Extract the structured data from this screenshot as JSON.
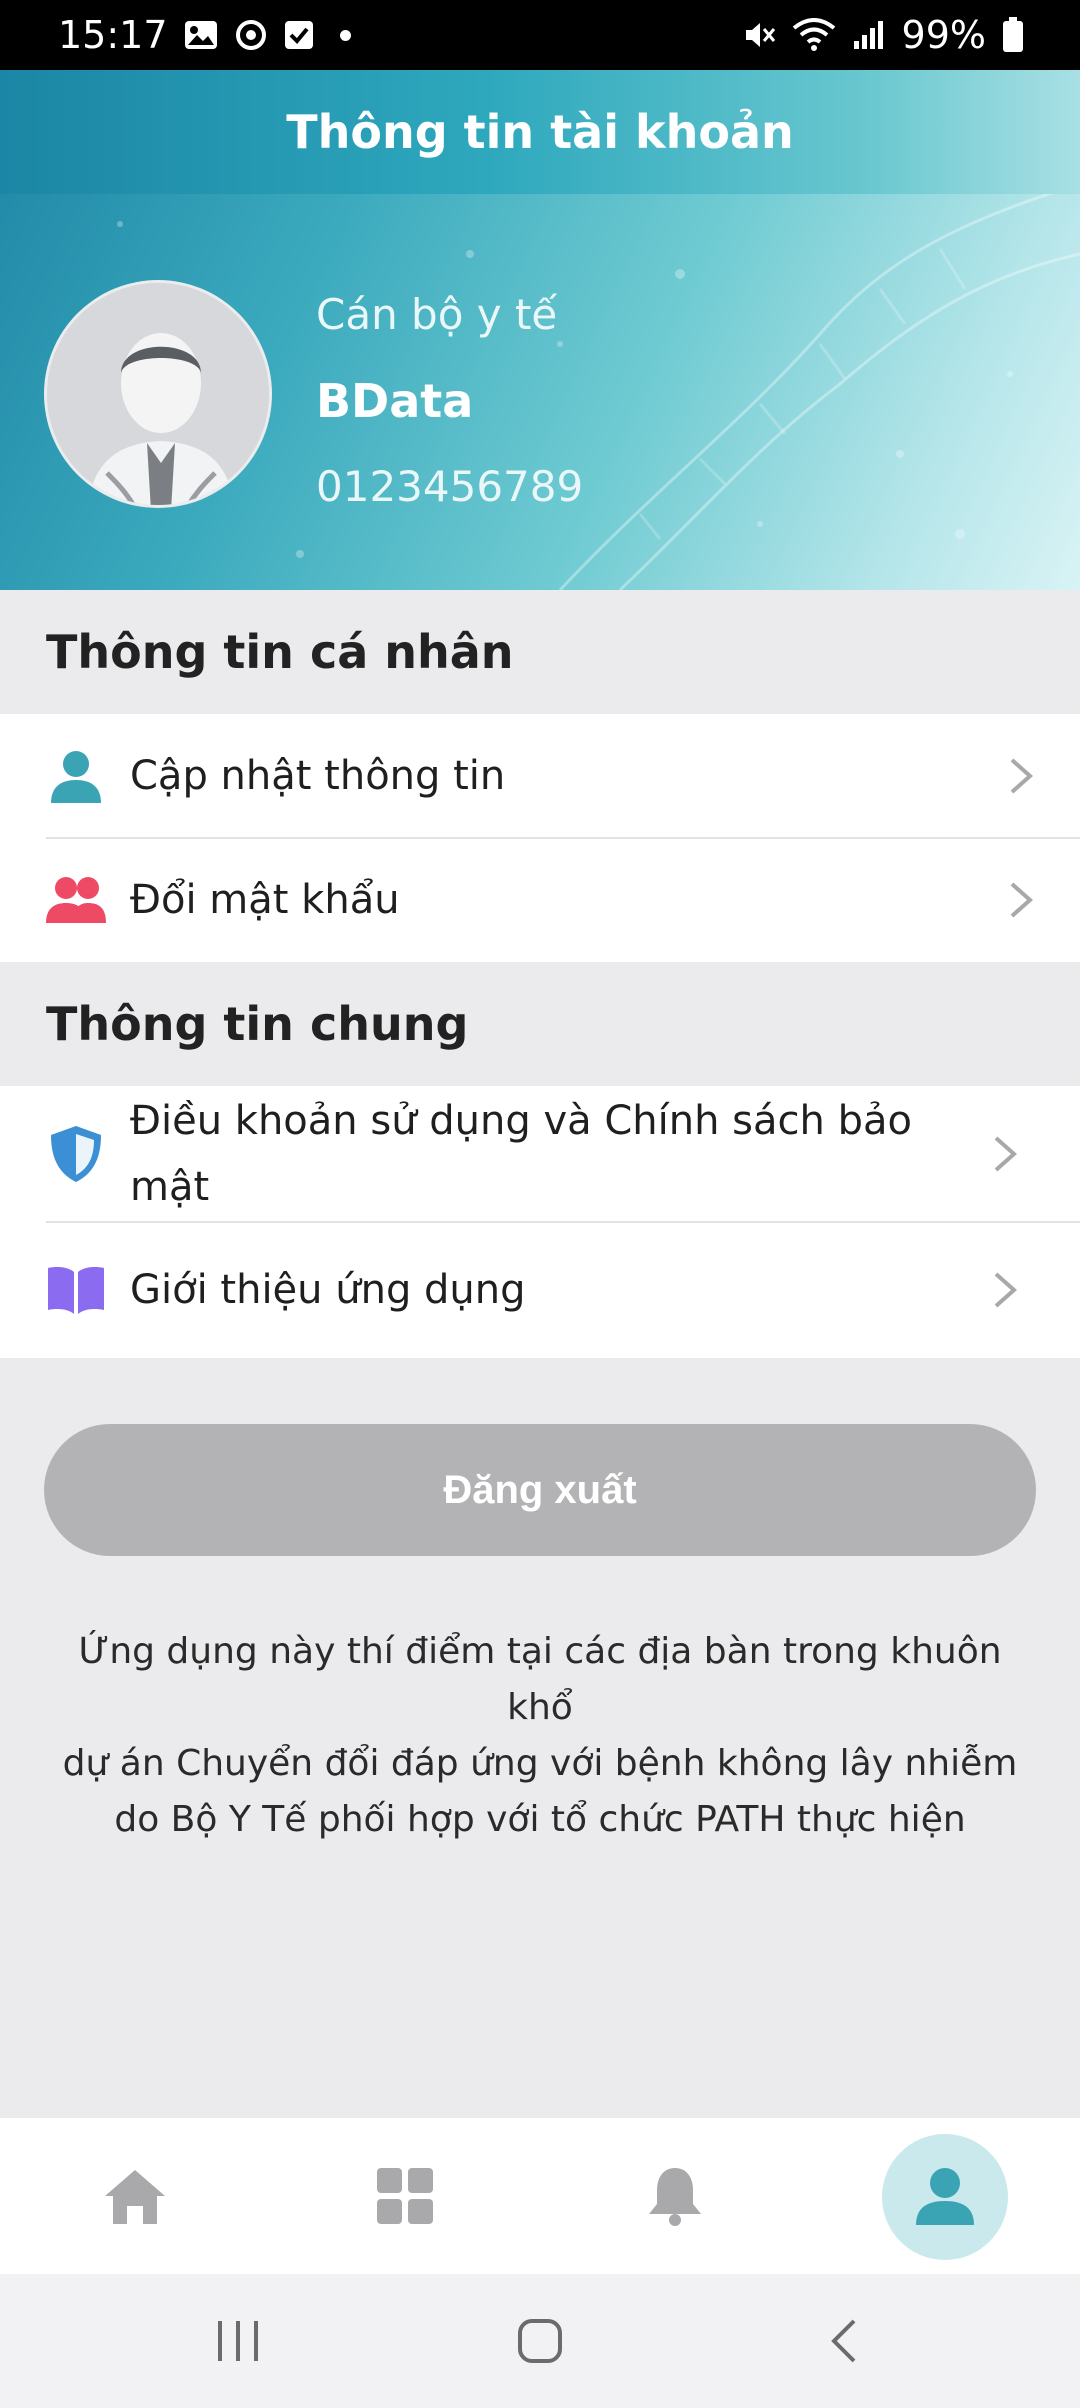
{
  "status_bar": {
    "time": "15:17",
    "battery": "99%",
    "icons": [
      "image-icon",
      "sync-icon",
      "checkbox-icon",
      "dot-icon",
      "mute-icon",
      "wifi-icon",
      "signal-icon",
      "battery-icon"
    ]
  },
  "header": {
    "title": "Thông tin tài khoản"
  },
  "profile": {
    "role": "Cán bộ y tế",
    "name": "BData",
    "phone": "0123456789"
  },
  "sections": {
    "personal": {
      "title": "Thông tin cá nhân",
      "items": [
        {
          "label": "Cập nhật thông tin",
          "icon": "user-icon",
          "color": "#3aa4b4"
        },
        {
          "label": "Đổi mật khẩu",
          "icon": "users-icon",
          "color": "#ee4a65"
        }
      ]
    },
    "general": {
      "title": "Thông tin chung",
      "items": [
        {
          "label_line1": "Điều khoản sử dụng và Chính sách bảo",
          "label_line2": "mật",
          "icon": "shield-icon",
          "color": "#3b8fd4"
        },
        {
          "label": "Giới thiệu ứng dụng",
          "icon": "book-icon",
          "color": "#8b6cf0"
        }
      ]
    }
  },
  "logout": {
    "label": "Đăng xuất"
  },
  "footnote": {
    "line1": "Ứng dụng này thí điểm tại các địa bàn trong khuôn khổ",
    "line2": "dự án Chuyển đổi đáp ứng với bệnh không lây nhiễm",
    "line3": "do Bộ Y Tế phối hợp với tổ chức PATH thực hiện"
  },
  "tabbar": {
    "tabs": [
      {
        "name": "home",
        "icon": "home-icon"
      },
      {
        "name": "apps",
        "icon": "grid-icon"
      },
      {
        "name": "notifications",
        "icon": "bell-icon"
      },
      {
        "name": "account",
        "icon": "user-icon",
        "active": true
      }
    ],
    "active_color": "#3aa4b4",
    "inactive_color": "#a9a9ab"
  }
}
